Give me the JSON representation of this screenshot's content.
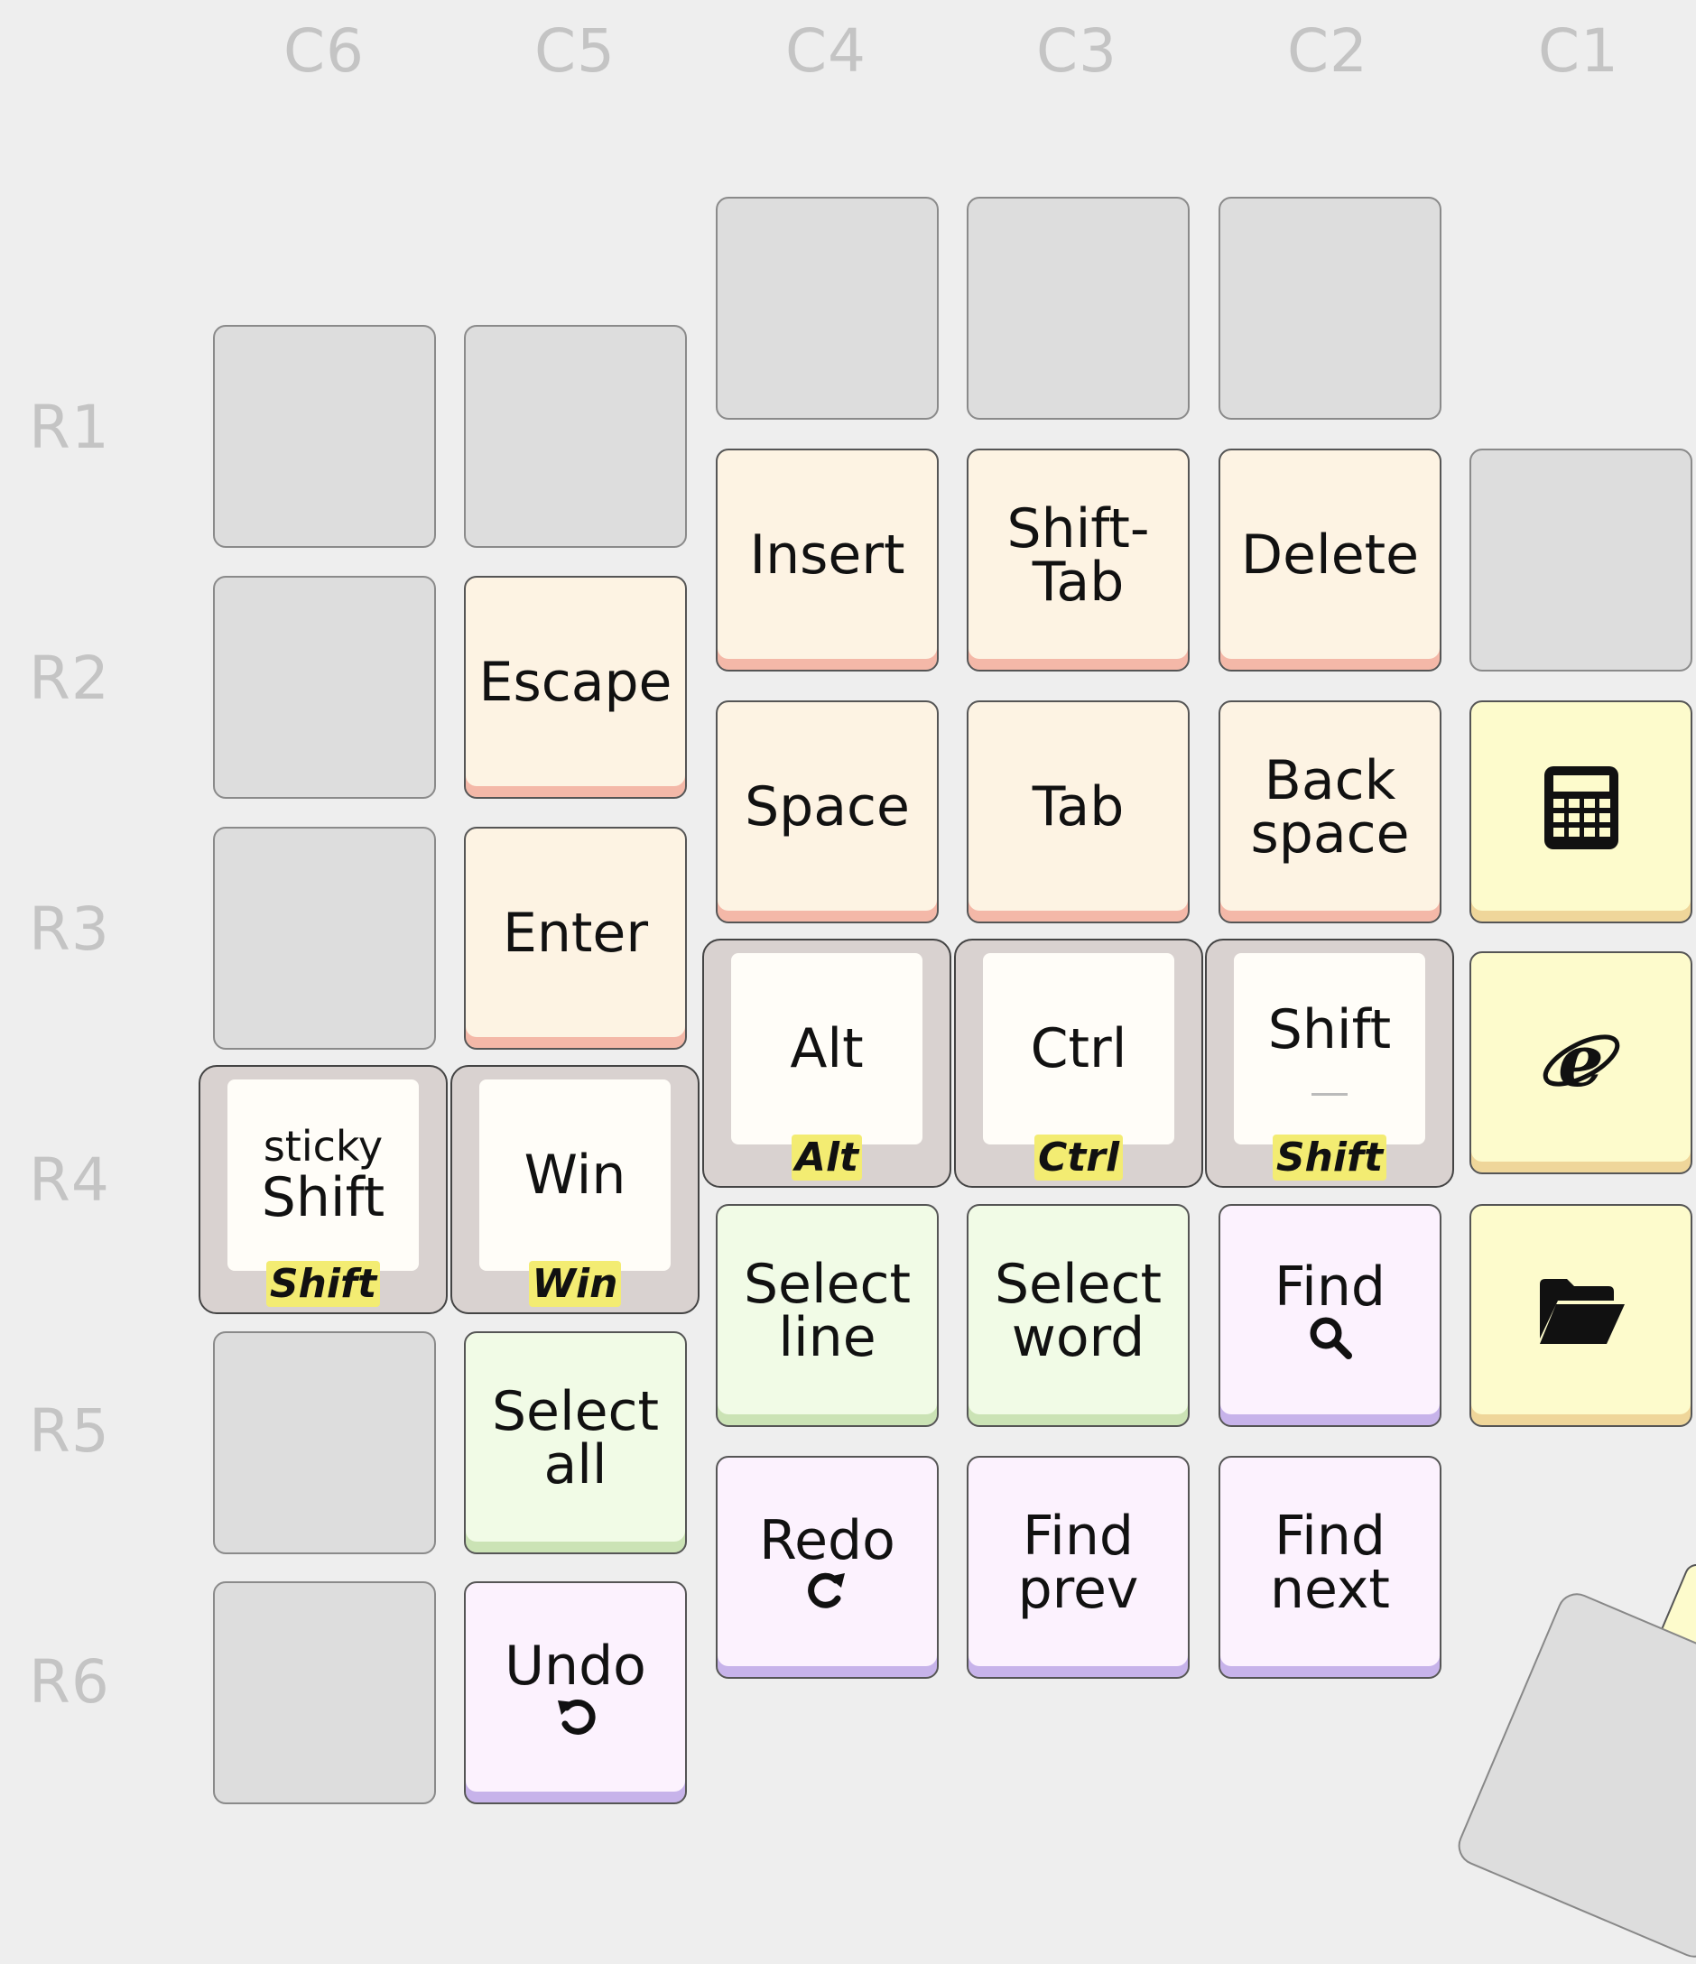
{
  "columns": [
    "C6",
    "C5",
    "C4",
    "C3",
    "C2",
    "C1"
  ],
  "rows": [
    "R1",
    "R2",
    "R3",
    "R4",
    "R5",
    "R6"
  ],
  "keys": {
    "insert": "Insert",
    "shift_tab_1": "Shift-",
    "shift_tab_2": "Tab",
    "delete": "Delete",
    "escape": "Escape",
    "space": "Space",
    "tab": "Tab",
    "backspace_1": "Back",
    "backspace_2": "space",
    "enter": "Enter",
    "select_line_1": "Select",
    "select_line_2": "line",
    "select_word_1": "Select",
    "select_word_2": "word",
    "find": "Find",
    "select_all_1": "Select",
    "select_all_2": "all",
    "redo": "Redo",
    "find_prev_1": "Find",
    "find_prev_2": "prev",
    "find_next_1": "Find",
    "find_next_2": "next",
    "undo": "Undo"
  },
  "mods": {
    "sticky_small": "sticky",
    "sticky_main": "Shift",
    "sticky_hold": "Shift",
    "win_main": "Win",
    "win_hold": "Win",
    "alt_main": "Alt",
    "alt_hold": "Alt",
    "ctrl_main": "Ctrl",
    "ctrl_hold": "Ctrl",
    "shift_main": "Shift",
    "shift_hold": "Shift"
  },
  "icons": {
    "calculator": "calculator-icon",
    "browser": "internet-explorer-icon",
    "folder": "folder-open-icon",
    "search": "magnifier-icon",
    "redo": "redo-arrow-icon",
    "undo": "undo-arrow-icon"
  },
  "colors": {
    "navigation": "#fdf3e3",
    "apps": "#fdfbcc",
    "selection": "#f1fbe6",
    "editing": "#fcf2fe",
    "modifier": "#d9d2d0",
    "hold_highlight": "#f3ec72"
  }
}
